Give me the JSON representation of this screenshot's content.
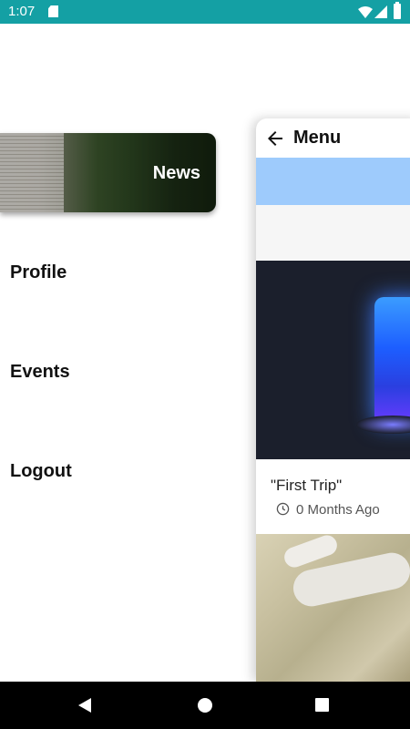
{
  "status_bar": {
    "time": "1:07"
  },
  "drawer": {
    "news_label": "News",
    "items": [
      {
        "label": "Profile"
      },
      {
        "label": "Events"
      },
      {
        "label": "Logout"
      }
    ]
  },
  "panel": {
    "title": "Menu",
    "posts": [
      {
        "title": "\"First Trip\"",
        "time_ago": "0 Months Ago"
      }
    ]
  },
  "colors": {
    "status_bar": "#14a0a4",
    "banner": "#9ecbfc",
    "nav_bar": "#000000"
  },
  "icons": {
    "status": [
      "sd-card-icon",
      "wifi-icon",
      "signal-icon",
      "battery-icon"
    ],
    "panel": [
      "arrow-back-icon",
      "clock-icon"
    ],
    "nav": [
      "nav-back-icon",
      "nav-home-icon",
      "nav-recents-icon"
    ]
  }
}
